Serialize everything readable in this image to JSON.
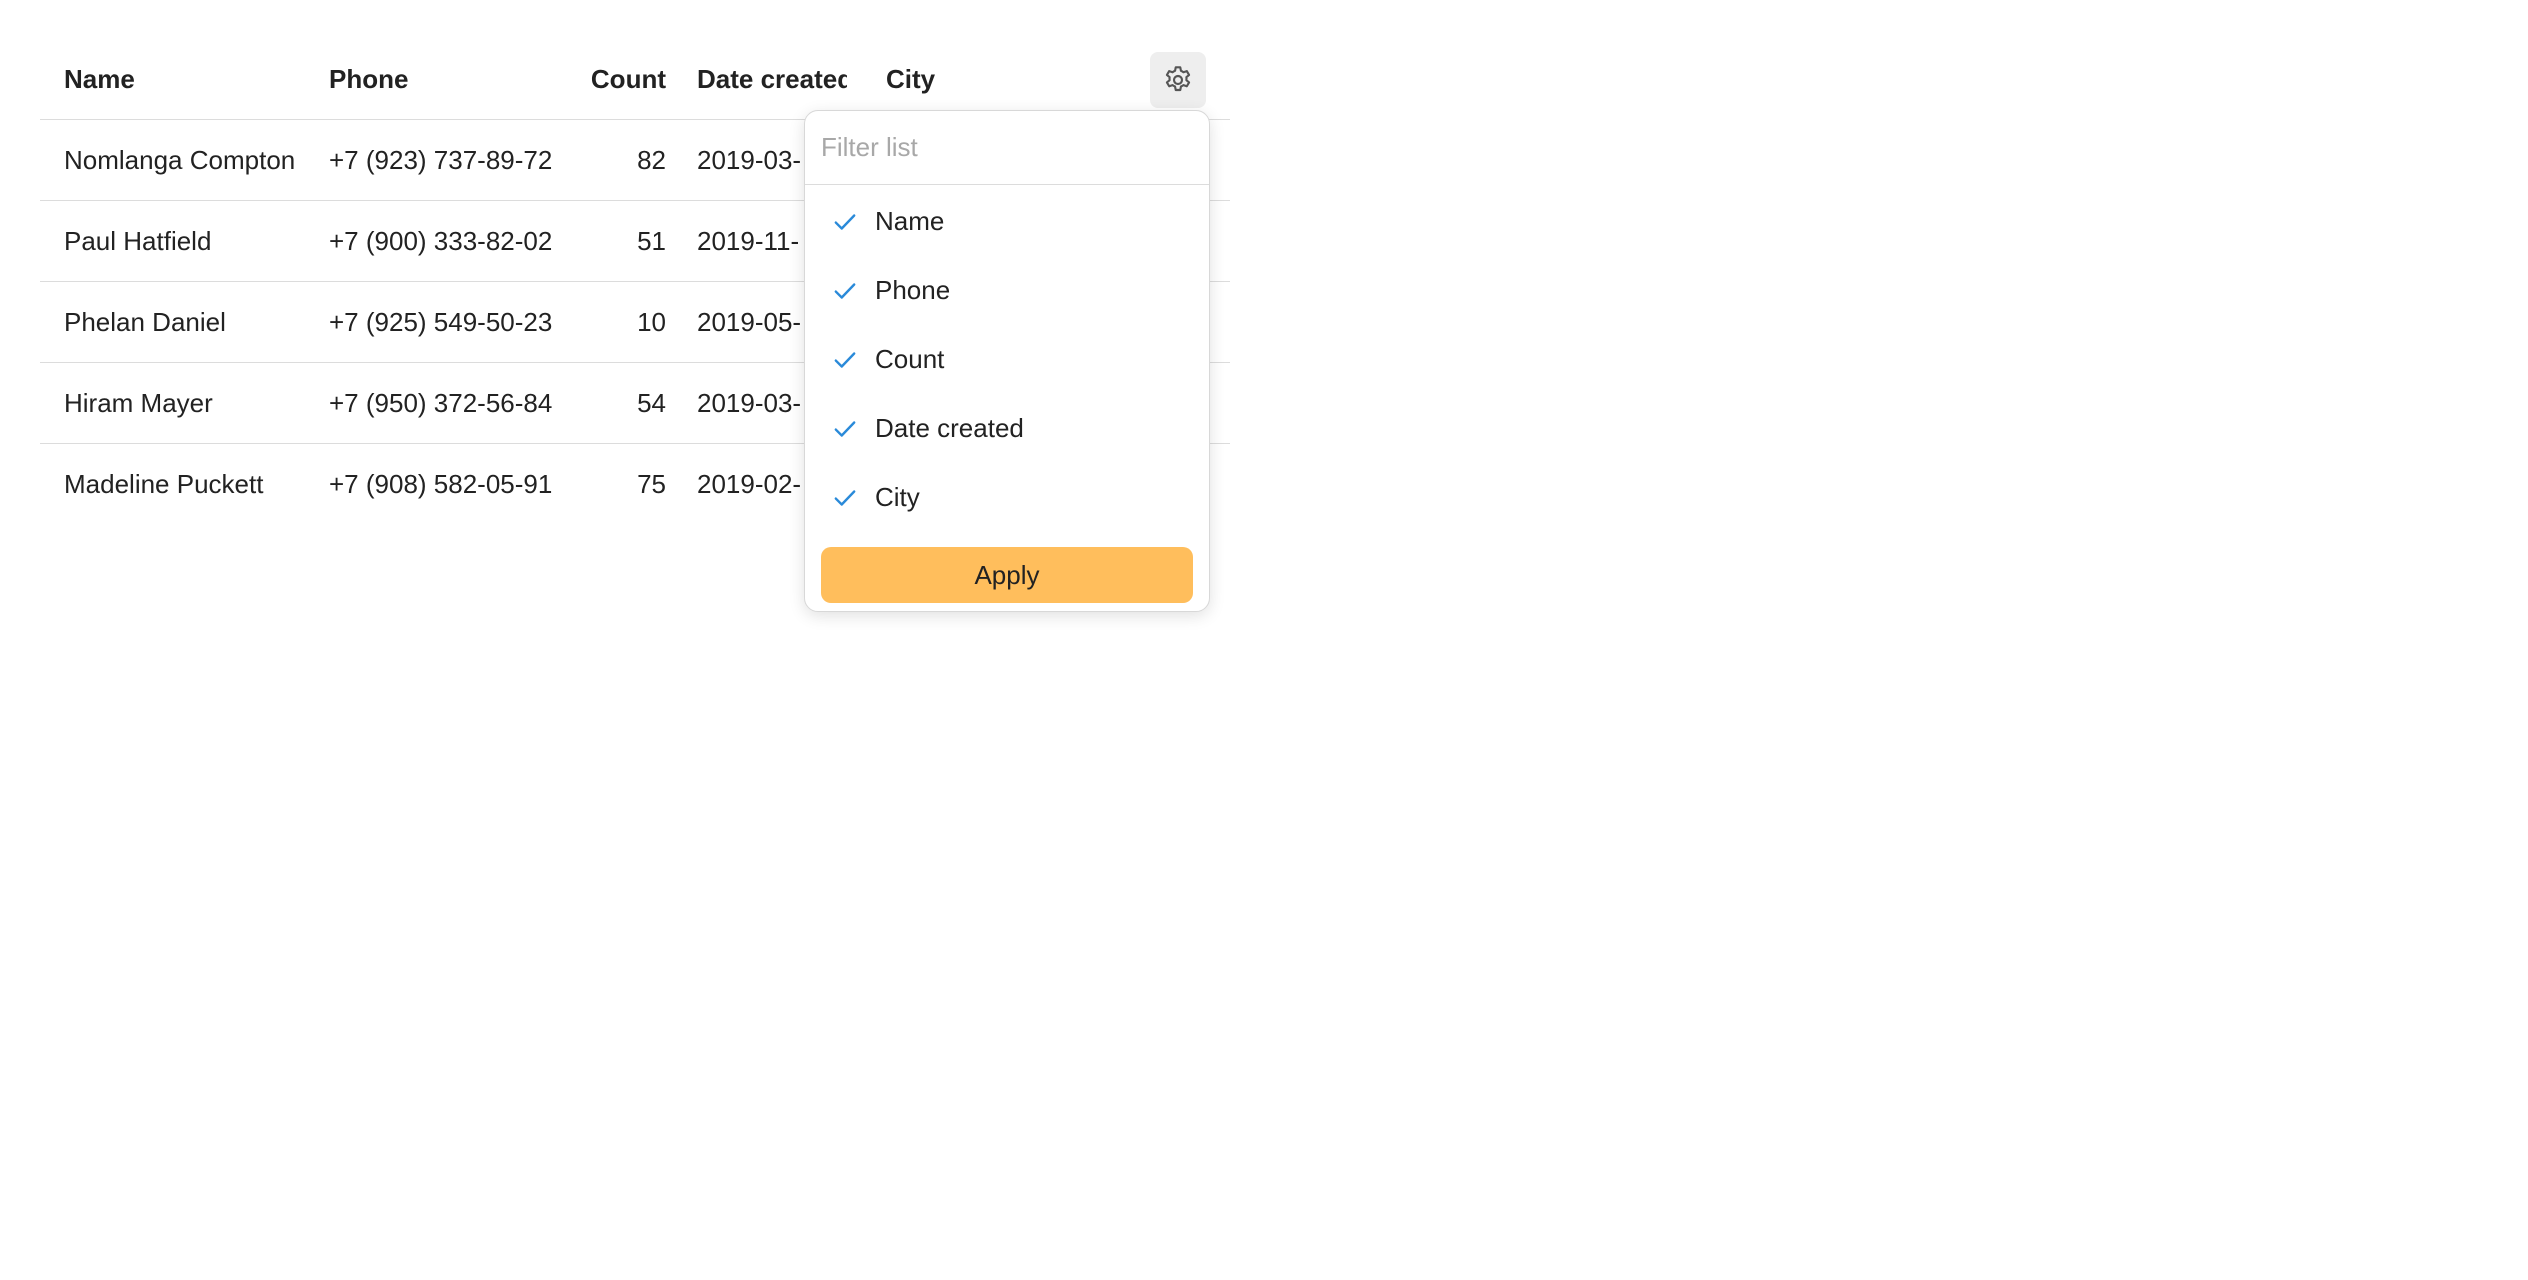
{
  "table": {
    "columns": {
      "name": "Name",
      "phone": "Phone",
      "count": "Count",
      "date": "Date created",
      "city": "City"
    },
    "rows": [
      {
        "name": "Nomlanga Compton",
        "phone": "+7 (923) 737-89-72",
        "count": "82",
        "date": "2019-03-"
      },
      {
        "name": "Paul Hatfield",
        "phone": "+7 (900) 333-82-02",
        "count": "51",
        "date": "2019-11-"
      },
      {
        "name": "Phelan Daniel",
        "phone": "+7 (925) 549-50-23",
        "count": "10",
        "date": "2019-05-"
      },
      {
        "name": "Hiram Mayer",
        "phone": "+7 (950) 372-56-84",
        "count": "54",
        "date": "2019-03-"
      },
      {
        "name": "Madeline Puckett",
        "phone": "+7 (908) 582-05-91",
        "count": "75",
        "date": "2019-02-"
      }
    ],
    "settings_icon": "gear-icon"
  },
  "column_picker": {
    "filter_placeholder": "Filter list",
    "filter_value": "",
    "options": [
      {
        "label": "Name",
        "checked": true
      },
      {
        "label": "Phone",
        "checked": true
      },
      {
        "label": "Count",
        "checked": true
      },
      {
        "label": "Date created",
        "checked": true
      },
      {
        "label": "City",
        "checked": true
      }
    ],
    "apply_label": "Apply"
  },
  "colors": {
    "check": "#2a8ad9",
    "apply_button": "#ffbe5c",
    "settings_button_bg": "#eeeeee",
    "border": "#dcdcdc",
    "placeholder": "#a8a8a8"
  }
}
